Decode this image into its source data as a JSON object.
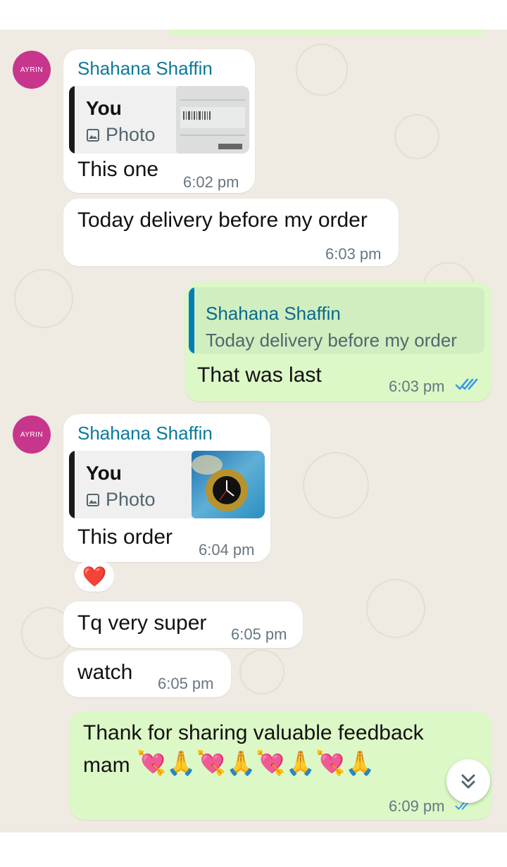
{
  "contact": {
    "name": "Shahana Shaffin",
    "avatar_text": "AYRIN"
  },
  "colors": {
    "incoming": "#ffffff",
    "outgoing": "#dcf8c6",
    "sender_name": "#0b7a99",
    "read_tick": "#3a9ae8"
  },
  "messages": [
    {
      "id": "m1",
      "direction": "in",
      "sender": "Shahana Shaffin",
      "quote": {
        "author": "You",
        "type": "Photo"
      },
      "text": "This one",
      "time": "6:02 pm"
    },
    {
      "id": "m2",
      "direction": "in",
      "text": "Today delivery before my order",
      "time": "6:03 pm"
    },
    {
      "id": "m3",
      "direction": "out",
      "quote": {
        "author": "Shahana Shaffin",
        "text": "Today delivery before my order"
      },
      "text": "That was last",
      "time": "6:03 pm",
      "status": "read"
    },
    {
      "id": "m4",
      "direction": "in",
      "sender": "Shahana Shaffin",
      "quote": {
        "author": "You",
        "type": "Photo"
      },
      "text": "This order",
      "time": "6:04 pm",
      "reaction": "❤️"
    },
    {
      "id": "m5",
      "direction": "in",
      "text": "Tq very super",
      "time": "6:05 pm"
    },
    {
      "id": "m6",
      "direction": "in",
      "text": "watch",
      "time": "6:05 pm"
    },
    {
      "id": "m7",
      "direction": "out",
      "text_line1": "Thank for sharing valuable feedback",
      "text_line2": "mam",
      "emojis": "💘🙏💘🙏💘🙏💘🙏",
      "time": "6:09 pm",
      "status": "read"
    }
  ],
  "icons": {
    "photo": "image-icon",
    "read_receipt": "double-check-icon",
    "scroll_down": "double-chevron-down-icon"
  }
}
